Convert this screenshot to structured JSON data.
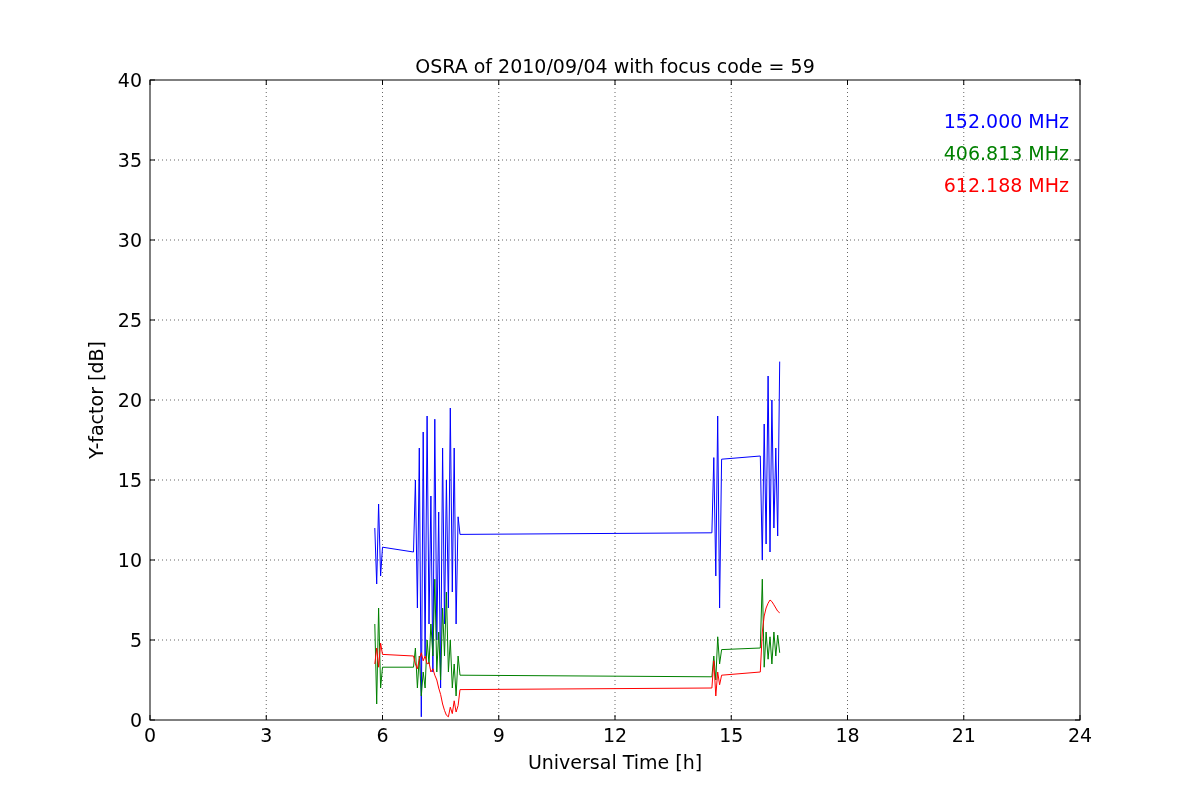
{
  "chart_data": {
    "type": "line",
    "title": "OSRA of 2010/09/04 with focus code = 59",
    "xlabel": "Universal Time [h]",
    "ylabel": "Y-factor [dB]",
    "xlim": [
      0,
      24
    ],
    "ylim": [
      0,
      40
    ],
    "xticks": [
      0,
      3,
      6,
      9,
      12,
      15,
      18,
      21,
      24
    ],
    "yticks": [
      0,
      5,
      10,
      15,
      20,
      25,
      30,
      35,
      40
    ],
    "grid": true,
    "x": [
      5.8,
      5.85,
      5.9,
      5.95,
      6.0,
      6.8,
      6.85,
      6.9,
      6.95,
      7.0,
      7.05,
      7.1,
      7.15,
      7.2,
      7.25,
      7.3,
      7.35,
      7.4,
      7.45,
      7.5,
      7.55,
      7.6,
      7.65,
      7.7,
      7.75,
      7.8,
      7.85,
      7.9,
      7.95,
      8.0,
      14.5,
      14.55,
      14.6,
      14.65,
      14.7,
      14.75,
      15.75,
      15.8,
      15.85,
      15.9,
      15.95,
      16.0,
      16.05,
      16.1,
      16.15,
      16.2,
      16.25
    ],
    "series": [
      {
        "name": "152.000 MHz",
        "color": "#0000ff",
        "values": [
          12,
          8.5,
          13.5,
          9,
          10.8,
          10.5,
          15,
          7,
          17,
          0.2,
          18,
          4,
          19,
          6,
          14,
          3,
          18.8,
          5,
          13,
          2,
          17,
          6,
          15,
          7,
          19.5,
          8,
          17,
          6,
          12.7,
          11.6,
          11.7,
          16.4,
          9,
          19,
          7,
          16.3,
          16.5,
          10,
          18.5,
          11,
          21.5,
          10.5,
          20,
          12,
          17,
          11.5,
          22.4
        ]
      },
      {
        "name": "406.813 MHz",
        "color": "#008000",
        "values": [
          6,
          1,
          7,
          2,
          3.3,
          3.3,
          4.5,
          2,
          4,
          1.5,
          3,
          2,
          5,
          3.5,
          6,
          4,
          8.8,
          3,
          5.5,
          2.5,
          7,
          4,
          8,
          3,
          5,
          2,
          3.5,
          1.5,
          4,
          2.8,
          2.7,
          4,
          2.5,
          5.2,
          3.5,
          4.4,
          4.5,
          8.8,
          3.3,
          5.5,
          3.8,
          5.2,
          3.5,
          5.5,
          4,
          5.3,
          4.2
        ]
      },
      {
        "name": "612.188 MHz",
        "color": "#ff0000",
        "values": [
          3.5,
          4.5,
          3.3,
          4.8,
          4.1,
          4.0,
          3.5,
          3.2,
          3.8,
          4.2,
          3.7,
          4.0,
          3.5,
          3.6,
          3.0,
          3.2,
          2.8,
          2.5,
          2.0,
          1.6,
          1.0,
          0.6,
          0.3,
          0.2,
          0.8,
          0.4,
          1.2,
          0.5,
          0.9,
          1.9,
          2.0,
          3.7,
          1.5,
          3.0,
          2.2,
          2.8,
          3.0,
          5.5,
          6.5,
          7.0,
          7.3,
          7.5,
          7.4,
          7.2,
          7.0,
          6.8,
          6.7
        ]
      }
    ]
  }
}
